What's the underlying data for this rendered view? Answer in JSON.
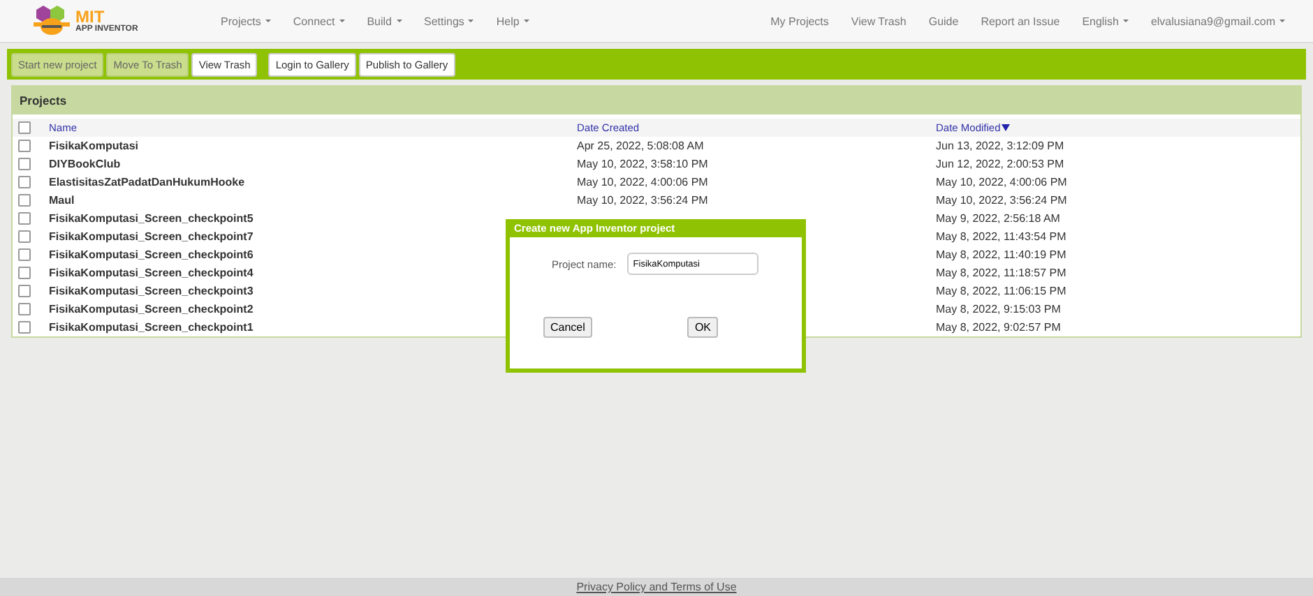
{
  "logo": {
    "title": "MIT",
    "subtitle": "APP INVENTOR"
  },
  "menu": [
    {
      "label": "Projects"
    },
    {
      "label": "Connect"
    },
    {
      "label": "Build"
    },
    {
      "label": "Settings"
    },
    {
      "label": "Help"
    }
  ],
  "right_links": [
    {
      "label": "My Projects",
      "dropdown": false
    },
    {
      "label": "View Trash",
      "dropdown": false
    },
    {
      "label": "Guide",
      "dropdown": false
    },
    {
      "label": "Report an Issue",
      "dropdown": false
    },
    {
      "label": "English",
      "dropdown": true
    },
    {
      "label": "elvalusiana9@gmail.com",
      "dropdown": true
    }
  ],
  "toolbar": [
    {
      "buttons": [
        {
          "label": "Start new project",
          "disabled": true
        },
        {
          "label": "Move To Trash",
          "disabled": true
        },
        {
          "label": "View Trash",
          "disabled": false
        }
      ]
    },
    {
      "buttons": [
        {
          "label": "Login to Gallery",
          "disabled": false
        },
        {
          "label": "Publish to Gallery",
          "disabled": false
        }
      ]
    }
  ],
  "panel": {
    "title": "Projects"
  },
  "table": {
    "select_all_checked": false,
    "columns": [
      {
        "label": "Name",
        "sorted": false
      },
      {
        "label": "Date Created",
        "sorted": false
      },
      {
        "label": "Date Modified",
        "sorted": true
      }
    ],
    "rows": [
      {
        "name": "FisikaKomputasi",
        "created": "Apr 25, 2022, 5:08:08 AM",
        "modified": "Jun 13, 2022, 3:12:09 PM",
        "checked": false
      },
      {
        "name": "DIYBookClub",
        "created": "May 10, 2022, 3:58:10 PM",
        "modified": "Jun 12, 2022, 2:00:53 PM",
        "checked": false
      },
      {
        "name": "ElastisitasZatPadatDanHukumHooke",
        "created": "May 10, 2022, 4:00:06 PM",
        "modified": "May 10, 2022, 4:00:06 PM",
        "checked": false
      },
      {
        "name": "Maul",
        "created": "May 10, 2022, 3:56:24 PM",
        "modified": "May 10, 2022, 3:56:24 PM",
        "checked": false
      },
      {
        "name": "FisikaKomputasi_Screen_checkpoint5",
        "modified": "May 9, 2022, 2:56:18 AM",
        "checked": false
      },
      {
        "name": "FisikaKomputasi_Screen_checkpoint7",
        "modified": "May 8, 2022, 11:43:54 PM",
        "checked": false
      },
      {
        "name": "FisikaKomputasi_Screen_checkpoint6",
        "modified": "May 8, 2022, 11:40:19 PM",
        "checked": false
      },
      {
        "name": "FisikaKomputasi_Screen_checkpoint4",
        "modified": "May 8, 2022, 11:18:57 PM",
        "checked": false
      },
      {
        "name": "FisikaKomputasi_Screen_checkpoint3",
        "modified": "May 8, 2022, 11:06:15 PM",
        "checked": false
      },
      {
        "name": "FisikaKomputasi_Screen_checkpoint2",
        "modified": "May 8, 2022, 9:15:03 PM",
        "checked": false
      },
      {
        "name": "FisikaKomputasi_Screen_checkpoint1",
        "modified": "May 8, 2022, 9:02:57 PM",
        "checked": false
      }
    ]
  },
  "dialog": {
    "title": "Create new App Inventor project",
    "field_label": "Project name:",
    "value": "FisikaKomputasi",
    "buttons": [
      "Cancel",
      "OK"
    ]
  },
  "footer": {
    "link": "Privacy Policy and Terms of Use"
  }
}
